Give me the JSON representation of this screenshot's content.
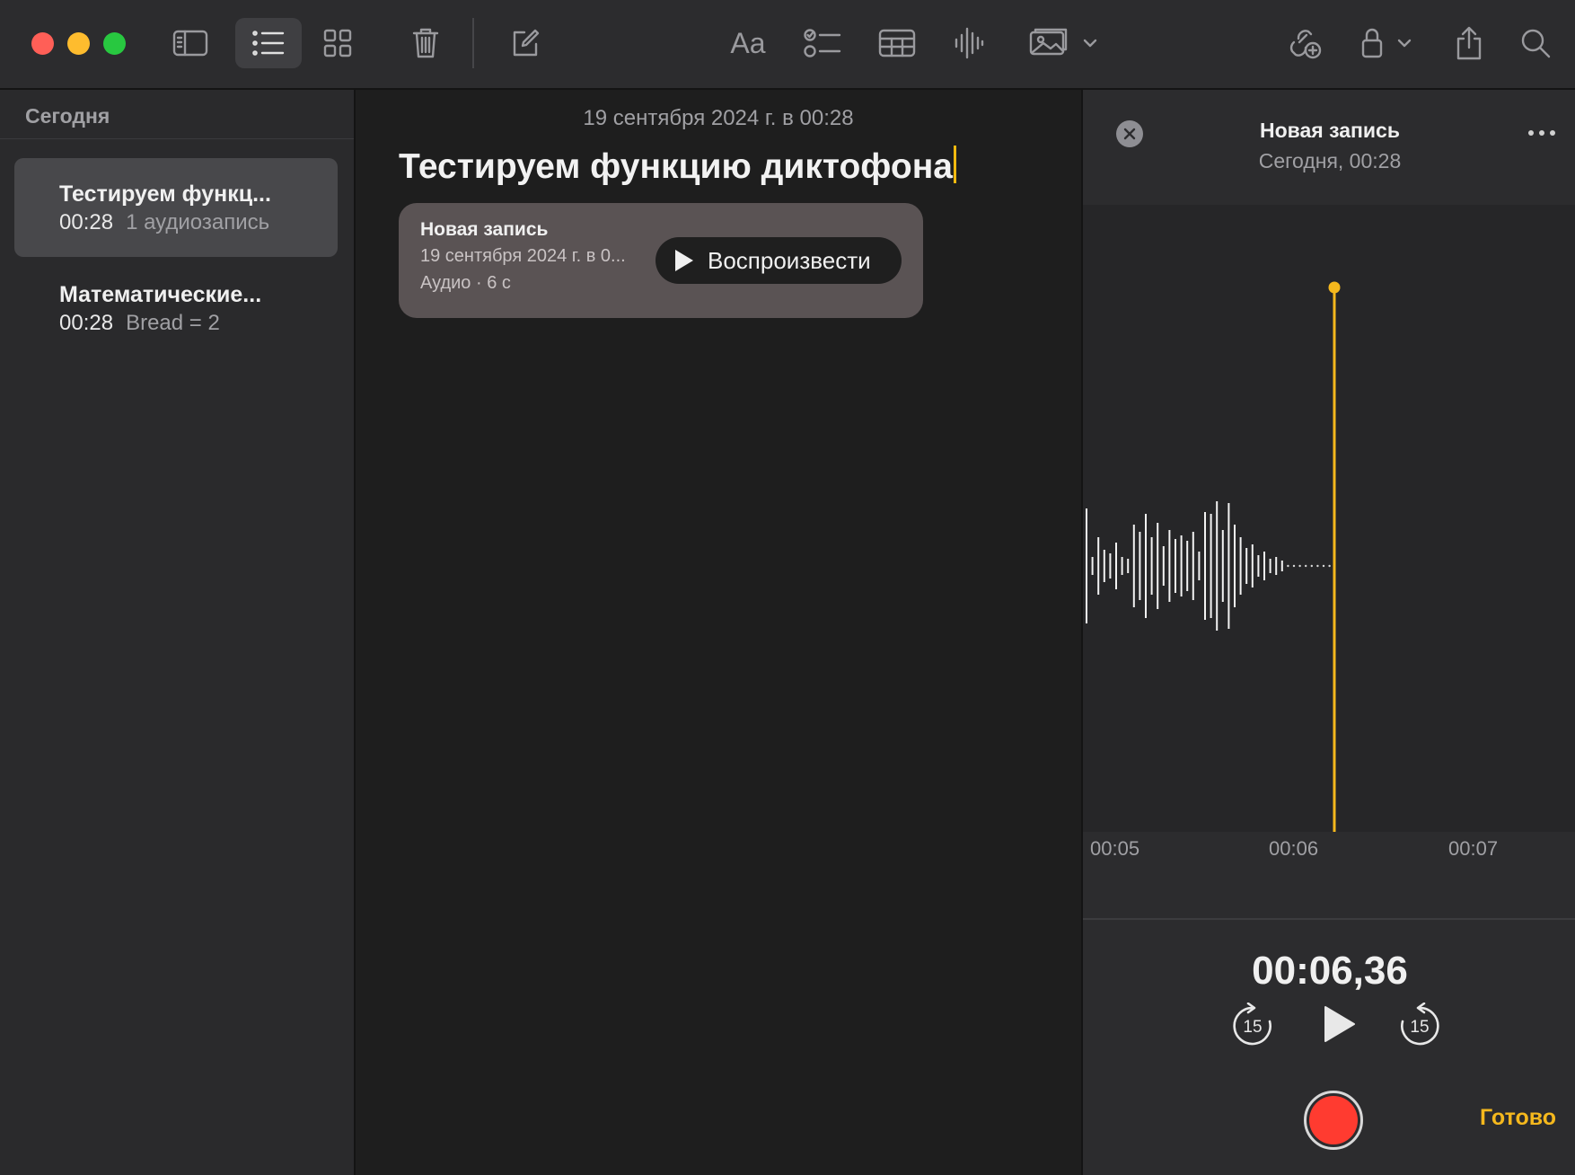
{
  "window": {
    "traffic_lights": {
      "close": "#ff5f57",
      "minimize": "#febc2e",
      "zoom": "#28c840"
    },
    "accent_color": "#f5b81d"
  },
  "toolbar": {
    "buttons": [
      {
        "id": "sidebar-toggle",
        "icon": "sidebar-icon"
      },
      {
        "id": "list-view",
        "icon": "list-icon",
        "active": true
      },
      {
        "id": "gallery-view",
        "icon": "grid-icon"
      },
      {
        "id": "delete",
        "icon": "trash-icon"
      },
      {
        "id": "new-note",
        "icon": "compose-icon"
      },
      {
        "id": "format",
        "icon": "text-format-icon",
        "label": "Aa"
      },
      {
        "id": "checklist",
        "icon": "checklist-icon"
      },
      {
        "id": "table",
        "icon": "table-icon"
      },
      {
        "id": "audio",
        "icon": "waveform-icon"
      },
      {
        "id": "media",
        "icon": "media-icon"
      },
      {
        "id": "collaborate",
        "icon": "collaborate-icon"
      },
      {
        "id": "lock",
        "icon": "lock-icon"
      },
      {
        "id": "share",
        "icon": "share-icon"
      },
      {
        "id": "search",
        "icon": "search-icon"
      }
    ]
  },
  "sidebar": {
    "section_title": "Сегодня",
    "notes": [
      {
        "title": "Тестируем функц...",
        "time": "00:28",
        "preview": "1 аудиозапись",
        "selected": true
      },
      {
        "title": "Математические...",
        "time": "00:28",
        "preview": "Bread = 2",
        "selected": false
      }
    ]
  },
  "editor": {
    "date": "19 сентября 2024 г. в 00:28",
    "title": "Тестируем функцию диктофона",
    "audio_card": {
      "title": "Новая запись",
      "date": "19 сентября 2024 г. в 0...",
      "meta": "Аудио · 6 с",
      "play_label": "Воспроизвести"
    }
  },
  "recorder": {
    "title": "Новая запись",
    "subtitle": "Сегодня, 00:28",
    "timeline_labels": [
      "00:05",
      "00:06",
      "00:07"
    ],
    "current_time": "00:06,36",
    "skip_back_seconds": "15",
    "skip_forward_seconds": "15",
    "done_label": "Готово",
    "record_color": "#ff3b30",
    "playhead_color": "#f5b81d"
  }
}
